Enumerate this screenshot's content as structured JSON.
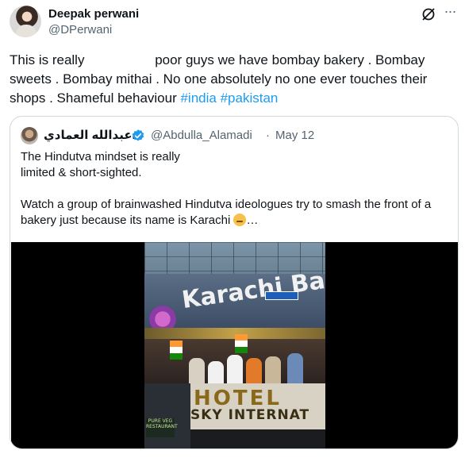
{
  "author": {
    "name": "Deepak perwani",
    "handle": "@DPerwani"
  },
  "post": {
    "text_start": "This is really",
    "text_rest": " poor guys we have bombay bakery . Bombay sweets . Bombay mithai . No one absolutely no one ever touches their shops . Shameful behaviour ",
    "hashtags": [
      "#india",
      "#pakistan"
    ]
  },
  "quote": {
    "name": "د.عبدالله العمادي",
    "handle": "@Abdulla_Alamadi",
    "separator": "·",
    "date": "May 12",
    "para1_line1": "The Hindutva mindset is really",
    "para1_line2": "limited & short-sighted.",
    "para2": "Watch a group of brainwashed Hindutva ideologues try to smash the front of a bakery just because its name is Karachi ",
    "ellipsis": "…"
  },
  "media": {
    "sign_text": "Karachi Ba",
    "hotel_line1": "HOTEL",
    "hotel_line2": "SKY INTERNAT",
    "lower_sign": "PURE VEG RESTAURANT"
  },
  "icons": {
    "grok": "grok-icon",
    "more": "more-icon",
    "verified": "verified-badge-icon",
    "emoji": "thinking-face-icon"
  },
  "colors": {
    "link": "#1d9bf0",
    "secondary_text": "#536471",
    "border": "#cfd9de"
  }
}
